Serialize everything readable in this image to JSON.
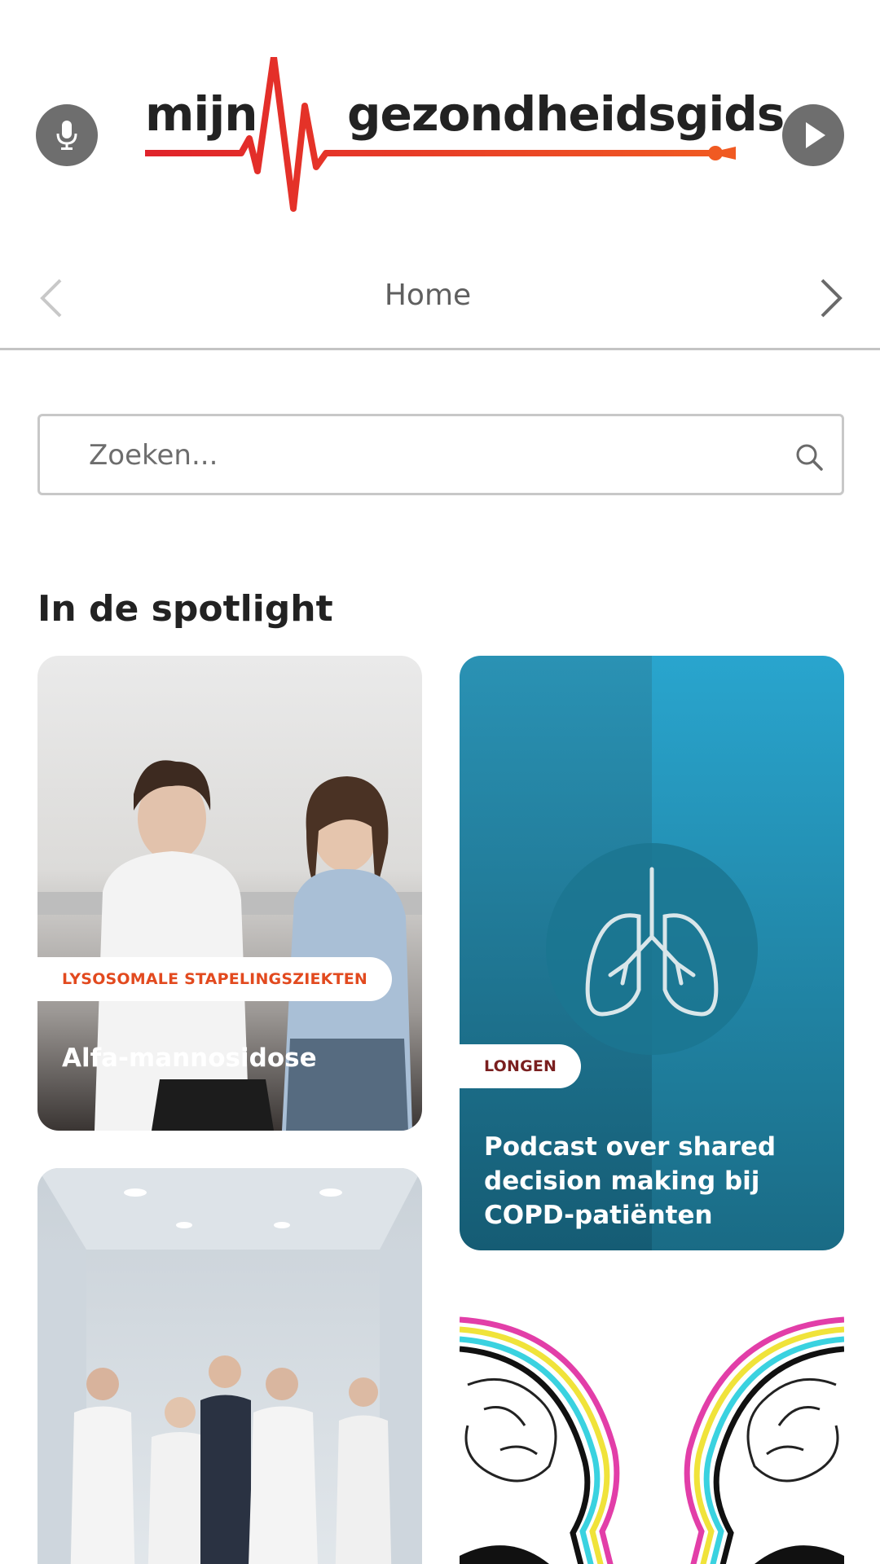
{
  "header": {
    "logo_word_1": "mijn",
    "logo_word_2": "gezondheidsgids",
    "mic_icon": "microphone-icon",
    "play_icon": "play-icon"
  },
  "nav": {
    "title": "Home",
    "prev_icon": "chevron-left-icon",
    "next_icon": "chevron-right-icon"
  },
  "search": {
    "placeholder": "Zoeken...",
    "icon": "search-icon"
  },
  "section": {
    "title": "In de spotlight"
  },
  "cards": [
    {
      "tag": "LYSOSOMALE STAPELINGSZIEKTEN",
      "title": "Alfa-mannosidose"
    },
    {
      "tag": "LONGEN",
      "title": "Podcast over shared decision making bij COPD-patiënten"
    },
    {
      "tag": "",
      "title": ""
    },
    {
      "tag": "",
      "title": ""
    }
  ],
  "colors": {
    "accent": "#e53a1c",
    "tag_red": "#e24a1f",
    "tag_dark": "#7a1f1f",
    "button_grey": "#6e6e6e",
    "lung_card": "#1e7f9e"
  }
}
